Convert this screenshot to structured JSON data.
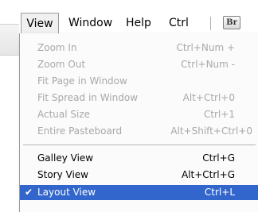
{
  "menubar": {
    "items": [
      {
        "label": "View"
      },
      {
        "label": "Window"
      },
      {
        "label": "Help"
      },
      {
        "label": "Ctrl"
      }
    ],
    "br_icon_label": "Br"
  },
  "view_menu": {
    "items": [
      {
        "label": "Zoom In",
        "shortcut": "Ctrl+Num +",
        "enabled": false
      },
      {
        "label": "Zoom Out",
        "shortcut": "Ctrl+Num -",
        "enabled": false
      },
      {
        "label": "Fit Page in Window",
        "shortcut": "",
        "enabled": false
      },
      {
        "label": "Fit Spread in Window",
        "shortcut": "Alt+Ctrl+0",
        "enabled": false
      },
      {
        "label": "Actual Size",
        "shortcut": "Ctrl+1",
        "enabled": false
      },
      {
        "label": "Entire Pasteboard",
        "shortcut": "Alt+Shift+Ctrl+0",
        "enabled": false
      },
      {
        "label": "Galley View",
        "shortcut": "Ctrl+G",
        "enabled": true
      },
      {
        "label": "Story View",
        "shortcut": "Alt+Ctrl+G",
        "enabled": true
      },
      {
        "label": "Layout View",
        "shortcut": "Ctrl+L",
        "enabled": true,
        "checked": true,
        "highlighted": true
      }
    ],
    "check_glyph": "✔"
  },
  "colors": {
    "highlight": "#3366cc",
    "disabled_text": "#a8a8a8"
  }
}
